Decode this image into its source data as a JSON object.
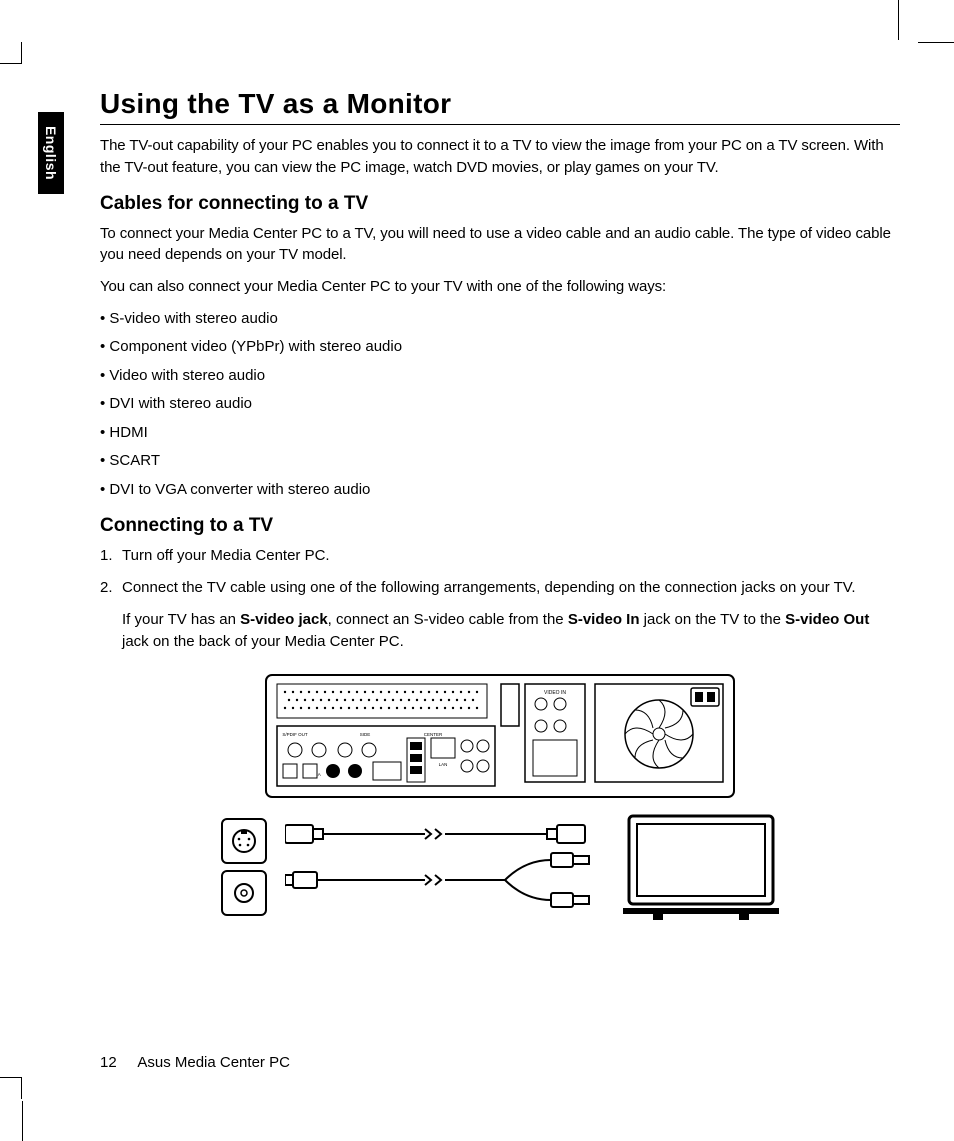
{
  "language_tab": "English",
  "heading": "Using the TV as a Monitor",
  "intro": "The TV-out capability of your PC enables you to connect it to a TV to view the image from your PC on a TV screen. With the TV-out feature, you can view the PC image, watch DVD movies, or play games on your TV.",
  "section_cables": {
    "title": "Cables for connecting to a TV",
    "p1": "To connect your Media Center PC to a TV, you will need to use a video cable and an audio cable. The type of video cable you need depends on your TV model.",
    "p2": "You can also connect your Media Center PC to your TV with one of the following ways:",
    "items": [
      "S-video with stereo audio",
      "Component video (YPbPr) with stereo audio",
      "Video with stereo audio",
      "DVI with stereo audio",
      "HDMI",
      "SCART",
      "DVI to VGA converter with stereo audio"
    ]
  },
  "section_connect": {
    "title": "Connecting to a TV",
    "steps": [
      "Turn off your Media Center PC.",
      "Connect the TV cable using one of the following arrangements, depending on the connection jacks on your TV."
    ],
    "svideo_p1a": "If your TV has an ",
    "svideo_b1": "S-video jack",
    "svideo_p1b": ", connect an S-video cable from the ",
    "svideo_b2": "S-video In",
    "svideo_p1c": " jack on the TV to the ",
    "svideo_b3": "S-video Out",
    "svideo_p1d": " jack on the back of your Media Center PC."
  },
  "diagram_labels": {
    "video_in": "VIDEO IN",
    "spdif_out": "S/PDIF OUT",
    "center": "CENTER",
    "opt": "OPT",
    "coa": "COA",
    "lan": "LAN"
  },
  "footer": {
    "page": "12",
    "title": "Asus Media Center PC"
  }
}
